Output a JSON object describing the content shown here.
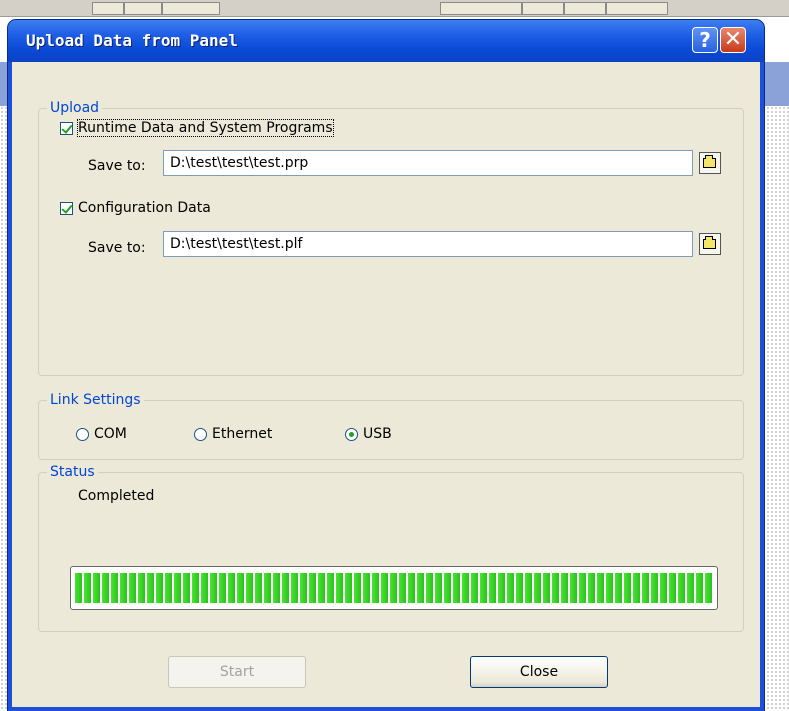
{
  "dialog": {
    "title": "Upload Data from Panel",
    "help_glyph": "?",
    "close_glyph": "✕"
  },
  "upload": {
    "legend": "Upload",
    "runtime": {
      "label": "Runtime Data and System Programs",
      "checked": true,
      "save_label": "Save to:",
      "path": "D:\\test\\test\\test.prp"
    },
    "config": {
      "label": "Configuration Data",
      "checked": true,
      "save_label": "Save to:",
      "path": "D:\\test\\test\\test.plf"
    }
  },
  "link": {
    "legend": "Link Settings",
    "options": [
      {
        "label": "COM",
        "selected": false
      },
      {
        "label": "Ethernet",
        "selected": false
      },
      {
        "label": "USB",
        "selected": true
      }
    ]
  },
  "status": {
    "legend": "Status",
    "text": "Completed",
    "progress": 1.0
  },
  "buttons": {
    "start": "Start",
    "close": "Close"
  },
  "colors": {
    "title_bar": "#0a4ad6",
    "legend_text": "#0046d5",
    "progress_green": "#33cc22",
    "face": "#ece9d8"
  }
}
